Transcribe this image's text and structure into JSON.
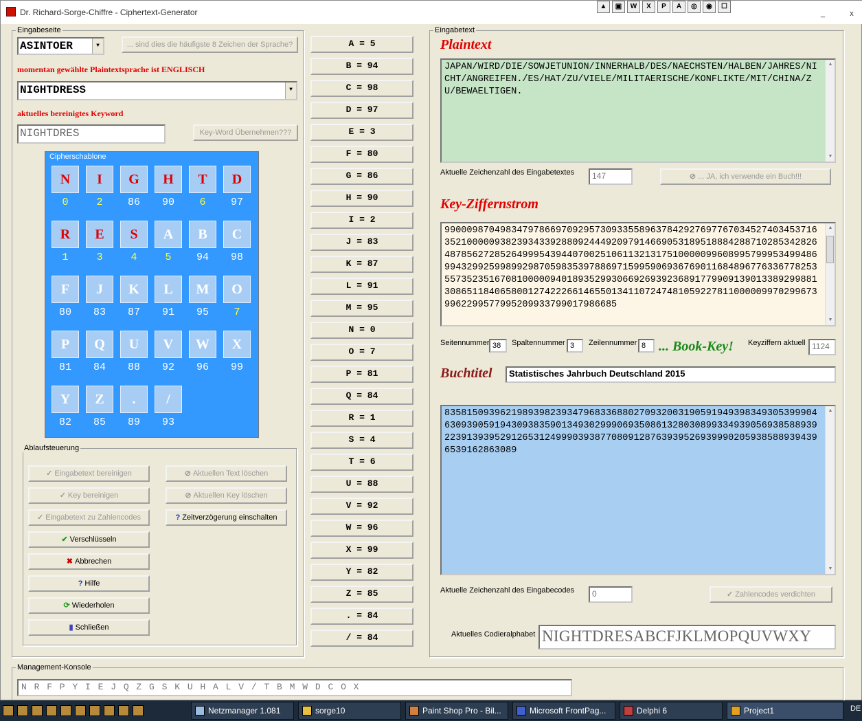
{
  "window": {
    "title": "Dr. Richard-Sorge-Chiffre - Ciphertext-Generator",
    "min": "_",
    "close": "x"
  },
  "toolbar_icons": [
    "▲",
    "▣",
    "W",
    "X",
    "P",
    "A",
    "◎",
    "◉",
    "☐"
  ],
  "left": {
    "group_label": "Eingabeseite",
    "language_combo": "ASINTOER",
    "frequency_button": "... sind dies die häufigste 8 Zeichen der Sprache?",
    "language_status": "momentan gewählte Plaintextsprache ist ENGLISCH",
    "keyword_combo": "NIGHTDRESS",
    "clean_keyword_label": "aktuelles bereinigtes Keyword",
    "clean_keyword_value": "NIGHTDRES",
    "take_keyword_button": "Key-Word Übernehmen???"
  },
  "cipher": {
    "label": "Cipherschablone",
    "cells": [
      {
        "ch": "N",
        "num": "0",
        "red": true,
        "yellow": true
      },
      {
        "ch": "I",
        "num": "2",
        "red": true,
        "yellow": true
      },
      {
        "ch": "G",
        "num": "86",
        "red": true,
        "yellow": false
      },
      {
        "ch": "H",
        "num": "90",
        "red": true,
        "yellow": false
      },
      {
        "ch": "T",
        "num": "6",
        "red": true,
        "yellow": true
      },
      {
        "ch": "D",
        "num": "97",
        "red": true,
        "yellow": false
      },
      {
        "ch": "R",
        "num": "1",
        "red": true,
        "yellow": true
      },
      {
        "ch": "E",
        "num": "3",
        "red": true,
        "yellow": true
      },
      {
        "ch": "S",
        "num": "4",
        "red": true,
        "yellow": true
      },
      {
        "ch": "A",
        "num": "5",
        "red": false,
        "yellow": true
      },
      {
        "ch": "B",
        "num": "94",
        "red": false,
        "yellow": false
      },
      {
        "ch": "C",
        "num": "98",
        "red": false,
        "yellow": false
      },
      {
        "ch": "F",
        "num": "80",
        "red": false,
        "yellow": false
      },
      {
        "ch": "J",
        "num": "83",
        "red": false,
        "yellow": false
      },
      {
        "ch": "K",
        "num": "87",
        "red": false,
        "yellow": false
      },
      {
        "ch": "L",
        "num": "91",
        "red": false,
        "yellow": false
      },
      {
        "ch": "M",
        "num": "95",
        "red": false,
        "yellow": false
      },
      {
        "ch": "O",
        "num": "7",
        "red": false,
        "yellow": true
      },
      {
        "ch": "P",
        "num": "81",
        "red": false,
        "yellow": false
      },
      {
        "ch": "Q",
        "num": "84",
        "red": false,
        "yellow": false
      },
      {
        "ch": "U",
        "num": "88",
        "red": false,
        "yellow": false
      },
      {
        "ch": "V",
        "num": "92",
        "red": false,
        "yellow": false
      },
      {
        "ch": "W",
        "num": "96",
        "red": false,
        "yellow": false
      },
      {
        "ch": "X",
        "num": "99",
        "red": false,
        "yellow": false
      },
      {
        "ch": "Y",
        "num": "82",
        "red": false,
        "yellow": false
      },
      {
        "ch": "Z",
        "num": "85",
        "red": false,
        "yellow": false
      },
      {
        "ch": ".",
        "num": "89",
        "red": false,
        "yellow": false
      },
      {
        "ch": "/",
        "num": "93",
        "red": false,
        "yellow": false
      }
    ]
  },
  "control": {
    "group_label": "Ablaufsteuerung",
    "clean_input": "Eingabetext bereinigen",
    "clean_key": "Key bereinigen",
    "to_codes": "Eingabetext zu Zahlencodes",
    "encrypt": "Verschlüsseln",
    "cancel": "Abbrechen",
    "help": "Hilfe",
    "repeat": "Wiederholen",
    "close": "Schließen",
    "delete_text": "Aktuellen Text löschen",
    "delete_key": "Aktuellen Key löschen",
    "delay": "Zeitverzögerung einschalten"
  },
  "keymap": [
    "A = 5",
    "B = 94",
    "C = 98",
    "D = 97",
    "E = 3",
    "F = 80",
    "G = 86",
    "H = 90",
    "I = 2",
    "J = 83",
    "K = 87",
    "L = 91",
    "M = 95",
    "N = 0",
    "O = 7",
    "P = 81",
    "Q = 84",
    "R = 1",
    "S = 4",
    "T = 6",
    "U = 88",
    "V = 92",
    "W = 96",
    "X = 99",
    "Y = 82",
    "Z = 85",
    ". = 84",
    "/ = 84"
  ],
  "right": {
    "group_label": "Eingabetext",
    "plaintext_heading": "Plaintext",
    "plaintext": "JAPAN/WIRD/DIE/SOWJETUNION/INNERHALB/DES/NAECHSTEN/HALBEN/JAHRES/NICHT/ANGREIFEN./ES/HAT/ZU/VIELE/MILITAERISCHE/KONFLIKTE/MIT/CHINA/ZU/BEWAELTIGEN.",
    "char_count_label": "Aktuelle Zeichenzahl des Eingabetextes",
    "char_count": "147",
    "book_button": "... JA, ich verwende ein Buch!!!",
    "keystream_heading": "Key-Ziffernstrom",
    "keystream": "9900098704983479786697092957309335589637842927697767034527403453716352100000938239343392880924449209791466905318951888428871028534282648785627285264999543944070025106113213175100000996089957999534994869943299259989929870598353978869715995906936769011684896776336778253557352351670810000094018935299306692693923689177990913901338929988130865118406580012742226614655013411072474810592278110000099702996739962299577995209933799017986685",
    "page_label": "Seitennummer",
    "page": "38",
    "col_label": "Spaltennummer",
    "col": "3",
    "row_label": "Zeilennummer",
    "row": "8",
    "bookkey": "... Book-Key!",
    "keydigits_label": "Keyziffern aktuell",
    "keydigits": "1124",
    "booktitle_heading": "Buchtitel",
    "booktitle": "Statistisches Jahrbuch Deutschland 2015",
    "codes": "8358150939621989398239347968336880270932003190591949398349305399904630939059194309383590134930299906935086132803089933493905693858893922391393952912653124999039387708091287639395269399902059385889394396539162863089",
    "code_count_label": "Aktuelle Zeichenzahl des Eingabecodes",
    "code_count": "0",
    "compress_button": "Zahlencodes verdichten",
    "alphabet_label": "Aktuelles Codieralphabet",
    "alphabet": "NIGHTDRESABCFJKLMOPQUVWXY"
  },
  "console": {
    "label": "Management-Konsole",
    "text": "N R F P Y I E J Q Z G S K U H A L V / T B M W D C O X"
  },
  "taskbar": {
    "items": [
      "Netzmanager 1.081",
      "sorge10",
      "Paint Shop Pro - Bil...",
      "Microsoft FrontPag...",
      "Delphi 6",
      "Project1"
    ],
    "lang": "DE"
  }
}
